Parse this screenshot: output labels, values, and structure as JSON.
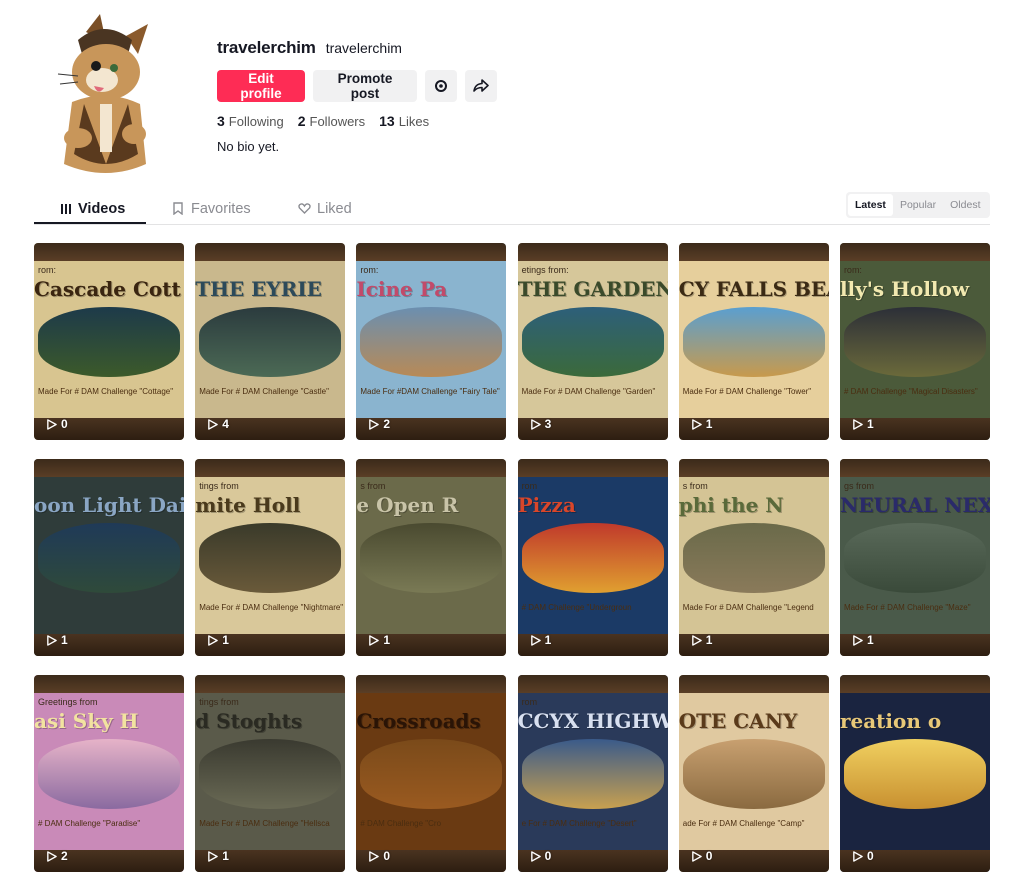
{
  "profile": {
    "username": "travelerchim",
    "nickname": "travelerchim",
    "bio": "No bio yet.",
    "buttons": {
      "edit": "Edit profile",
      "promote": "Promote post"
    },
    "stats": {
      "following_count": "3",
      "following_label": "Following",
      "followers_count": "2",
      "followers_label": "Followers",
      "likes_count": "13",
      "likes_label": "Likes"
    }
  },
  "tabs": [
    {
      "label": "Videos",
      "active": true,
      "icon": "grid-icon"
    },
    {
      "label": "Favorites",
      "active": false,
      "icon": "bookmark-icon"
    },
    {
      "label": "Liked",
      "active": false,
      "icon": "heart-icon"
    }
  ],
  "sort": [
    {
      "label": "Latest",
      "active": true
    },
    {
      "label": "Popular",
      "active": false
    },
    {
      "label": "Oldest",
      "active": false
    }
  ],
  "videos": [
    {
      "views": "0",
      "greet": "rom:",
      "title": "Cascade Cott",
      "made": "Made For # DAM Challenge \"Cottage\"",
      "bg": "#d8c590",
      "title_color": "#3a2510",
      "scene": [
        "#1d3a4a",
        "#3c5a2a"
      ]
    },
    {
      "views": "4",
      "greet": "",
      "title": "THE EYRIE",
      "made": "Made For # DAM Challenge \"Castle\"",
      "bg": "#c9b88d",
      "title_color": "#2c4a5a",
      "scene": [
        "#2b3b3e",
        "#4c6a55"
      ]
    },
    {
      "views": "2",
      "greet": "rom:",
      "title": "Icine Pa",
      "made": "Made For #DAM Challenge \"Fairy Tale\"",
      "bg": "#8ab4cf",
      "title_color": "#c24a6a",
      "scene": [
        "#6b8fb0",
        "#b88a56"
      ]
    },
    {
      "views": "3",
      "greet": "etings from:",
      "title": "THE GARDEN",
      "made": "Made For # DAM Challenge \"Garden\"",
      "bg": "#d6c79a",
      "title_color": "#3a4a2a",
      "scene": [
        "#2d5f7a",
        "#3b6a3a"
      ]
    },
    {
      "views": "1",
      "greet": "",
      "title": "CY FALLS BEAC",
      "made": "Made For # DAM Challenge \"Tower\"",
      "bg": "#e6cf9c",
      "title_color": "#3b2a14",
      "scene": [
        "#5a9fd0",
        "#c89a4c"
      ]
    },
    {
      "views": "1",
      "greet": "rom:",
      "title": "lly's Hollow",
      "made": "# DAM Challenge \"Magical Disasters\"",
      "bg": "#4b5a3a",
      "title_color": "#f2e9b0",
      "scene": [
        "#2c2f38",
        "#6b6a3a"
      ]
    },
    {
      "views": "1",
      "greet": "",
      "title": "oon Light Dairy",
      "made": "",
      "bg": "#2f3c3a",
      "title_color": "#8aa6c4",
      "scene": [
        "#1f3a58",
        "#2f4a3a"
      ]
    },
    {
      "views": "1",
      "greet": "tings from",
      "title": "mite Holl",
      "made": "Made For # DAM Challenge \"Nightmare\"",
      "bg": "#d9c89a",
      "title_color": "#4a3a1c",
      "scene": [
        "#3a3a2a",
        "#6a5a3a"
      ]
    },
    {
      "views": "1",
      "greet": "s from",
      "title": "e Open R",
      "made": "",
      "bg": "#6b6a4a",
      "title_color": "#c9c4a8",
      "scene": [
        "#4a4a30",
        "#7a7a55"
      ]
    },
    {
      "views": "1",
      "greet": "rom",
      "title": "Pizza",
      "made": "# DAM Challenge \"Undergroun",
      "bg": "#1b3a66",
      "title_color": "#d9462a",
      "scene": [
        "#c0392b",
        "#e0a030"
      ]
    },
    {
      "views": "1",
      "greet": "s from",
      "title": "phi the N",
      "made": "Made For # DAM Challenge \"Legend",
      "bg": "#d4c495",
      "title_color": "#5a6a3a",
      "scene": [
        "#6a6a4a",
        "#8a7a5a"
      ]
    },
    {
      "views": "1",
      "greet": "gs from",
      "title": "NEURAL NEX",
      "made": "Made For # DAM Challenge \"Maze\"",
      "bg": "#4a5a4a",
      "title_color": "#2a2a6a",
      "scene": [
        "#5a6a5a",
        "#3a4a3a"
      ]
    },
    {
      "views": "2",
      "greet": "Greetings from",
      "title": "asi Sky H",
      "made": "# DAM Challenge \"Paradise\"",
      "bg": "#c98ab8",
      "title_color": "#f2e3a0",
      "scene": [
        "#e6b3c8",
        "#8a6aa0"
      ]
    },
    {
      "views": "1",
      "greet": "tings from",
      "title": "d Stoghts",
      "made": "Made For # DAM Challenge \"Hellsca",
      "bg": "#5a5a4a",
      "title_color": "#2a2a22",
      "scene": [
        "#3a3a30",
        "#6a6a55"
      ]
    },
    {
      "views": "0",
      "greet": "",
      "title": "Crossroads",
      "made": "# DAM Challenge \"Cro",
      "bg": "#6a3a12",
      "title_color": "#2a1406",
      "scene": [
        "#7a4a1a",
        "#9a5a20"
      ]
    },
    {
      "views": "0",
      "greet": "rom",
      "title": "CCYX HIGHWA",
      "made": "e For # DAM Challenge \"Desert\"",
      "bg": "#2a3a5a",
      "title_color": "#d8e0f0",
      "scene": [
        "#3a5a8a",
        "#c8a050"
      ]
    },
    {
      "views": "0",
      "greet": "",
      "title": "OTE CANY",
      "made": "ade For # DAM Challenge \"Camp\"",
      "bg": "#e0c9a0",
      "title_color": "#5a3a1a",
      "scene": [
        "#c8a070",
        "#8a6a40"
      ]
    },
    {
      "views": "0",
      "greet": "",
      "title": "reation o",
      "made": "",
      "bg": "#1a2440",
      "title_color": "#e8c878",
      "scene": [
        "#f0d060",
        "#c89030"
      ]
    }
  ]
}
